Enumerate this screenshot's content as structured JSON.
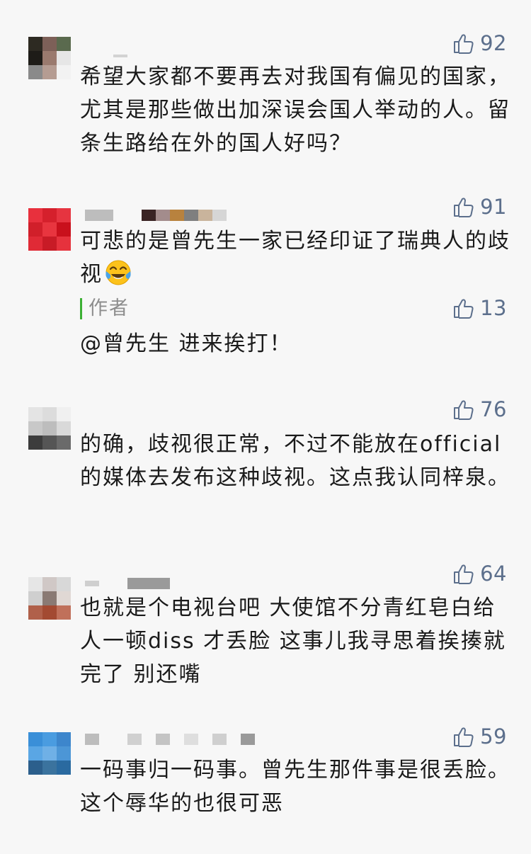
{
  "colors": {
    "like_blue": "#5c6f8c",
    "author_bar": "#3cb034",
    "text": "#1a1a1a",
    "background": "#f7f7f7"
  },
  "icons": {
    "like": "thumbs-up-icon",
    "emoji": "tears-of-joy-emoji"
  },
  "comments": [
    {
      "likes": "92",
      "text": "希望大家都不要再去对我国有偏见的国家，尤其是那些做出加深误会国人举动的人。留条生路给在外的国人好吗？"
    },
    {
      "likes": "91",
      "text": "可悲的是曾先生一家已经印证了瑞典人的歧视",
      "reply": {
        "author_label": "作者",
        "likes": "13",
        "text": "@曾先生 进来挨打！"
      }
    },
    {
      "likes": "76",
      "text": "的确，歧视很正常，不过不能放在official的媒体去发布这种歧视。这点我认同梓泉。"
    },
    {
      "likes": "64",
      "text": "也就是个电视台吧 大使馆不分青红皂白给人一顿diss 才丢脸 这事儿我寻思着挨揍就完了 别还嘴"
    },
    {
      "likes": "59",
      "text": "一码事归一码事。曾先生那件事是很丢脸。这个辱华的也很可恶"
    }
  ]
}
